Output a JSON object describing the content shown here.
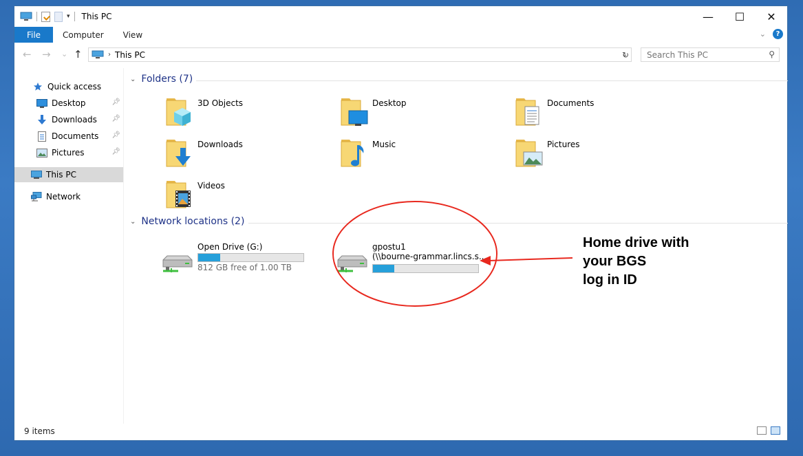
{
  "window": {
    "title": "This PC",
    "controls": {
      "minimize": "—",
      "maximize": "☐",
      "close": "✕"
    }
  },
  "ribbon": {
    "tabs": [
      "File",
      "Computer",
      "View"
    ],
    "help": "?"
  },
  "navigation": {
    "back": "←",
    "forward": "→",
    "recent": "⌄",
    "up": "↑",
    "address": {
      "crumb": "This PC"
    },
    "search": {
      "placeholder": "Search This PC"
    }
  },
  "sidebar": {
    "items": [
      {
        "label": "Quick access",
        "icon": "star-icon"
      },
      {
        "label": "Desktop",
        "icon": "desktop-icon",
        "pinned": true
      },
      {
        "label": "Downloads",
        "icon": "download-arrow-icon",
        "pinned": true
      },
      {
        "label": "Documents",
        "icon": "document-icon",
        "pinned": true
      },
      {
        "label": "Pictures",
        "icon": "picture-icon",
        "pinned": true
      },
      {
        "label": "This PC",
        "icon": "computer-icon",
        "selected": true
      },
      {
        "label": "Network",
        "icon": "network-icon"
      }
    ]
  },
  "folders": {
    "header": "Folders (7)",
    "items": [
      {
        "label": "3D Objects",
        "overlay": "cube"
      },
      {
        "label": "Desktop",
        "overlay": "desktop"
      },
      {
        "label": "Documents",
        "overlay": "document"
      },
      {
        "label": "Downloads",
        "overlay": "download"
      },
      {
        "label": "Music",
        "overlay": "music"
      },
      {
        "label": "Pictures",
        "overlay": "picture"
      },
      {
        "label": "Videos",
        "overlay": "video"
      }
    ]
  },
  "network_locations": {
    "header": "Network locations (2)",
    "drives": [
      {
        "name": "Open Drive (G:)",
        "path": "",
        "usage_fraction": 0.21,
        "free_text": "812 GB free of 1.00 TB"
      },
      {
        "name": "gpostu1",
        "path": "(\\\\bourne-grammar.lincs.s...",
        "usage_fraction": 0.2,
        "free_text": ""
      }
    ]
  },
  "statusbar": {
    "count": "9 items"
  },
  "annotation": {
    "text": "Home drive with\nyour BGS\nlog in ID",
    "color": "#e8281e"
  }
}
